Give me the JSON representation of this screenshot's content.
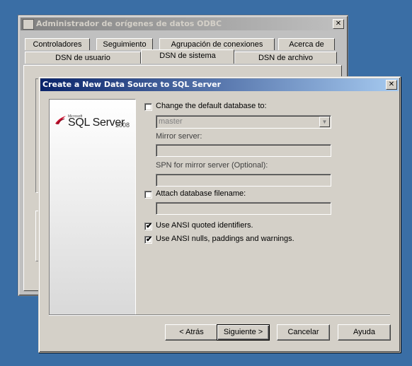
{
  "back_window": {
    "title": "Administrador de orígenes de datos ODBC",
    "tabs_row1": [
      "Controladores",
      "Seguimiento",
      "Agrupación de conexiones",
      "Acerca de"
    ],
    "tabs_row2": [
      "DSN de usuario",
      "DSN de sistema",
      "DSN de archivo"
    ],
    "selected_tab": "DSN de sistema",
    "close_glyph": "✕"
  },
  "dialog": {
    "title": "Create a New Data Source to SQL Server",
    "close_glyph": "✕",
    "logo": {
      "microsoft": "Microsoft",
      "product": "SQL Server",
      "version": "2008"
    },
    "options": {
      "change_default_db": {
        "label": "Change the default database to:",
        "checked": false
      },
      "default_db_value": "master",
      "mirror_server_label": "Mirror server:",
      "mirror_server_value": "",
      "spn_label": "SPN for mirror server (Optional):",
      "spn_value": "",
      "attach_db": {
        "label": "Attach database filename:",
        "checked": false
      },
      "attach_db_value": "",
      "ansi_quoted": {
        "label": "Use ANSI quoted identifiers.",
        "checked": true
      },
      "ansi_nulls": {
        "label": "Use ANSI nulls, paddings and warnings.",
        "checked": true
      }
    },
    "buttons": {
      "back": "< Atrás",
      "next": "Siguiente >",
      "cancel": "Cancelar",
      "help": "Ayuda"
    },
    "check_glyph": "✔"
  },
  "colors": {
    "desktop": "#3a6ea5",
    "active_title": "#0a246a",
    "inactive_title": "#808080",
    "face": "#d4d0c8"
  }
}
